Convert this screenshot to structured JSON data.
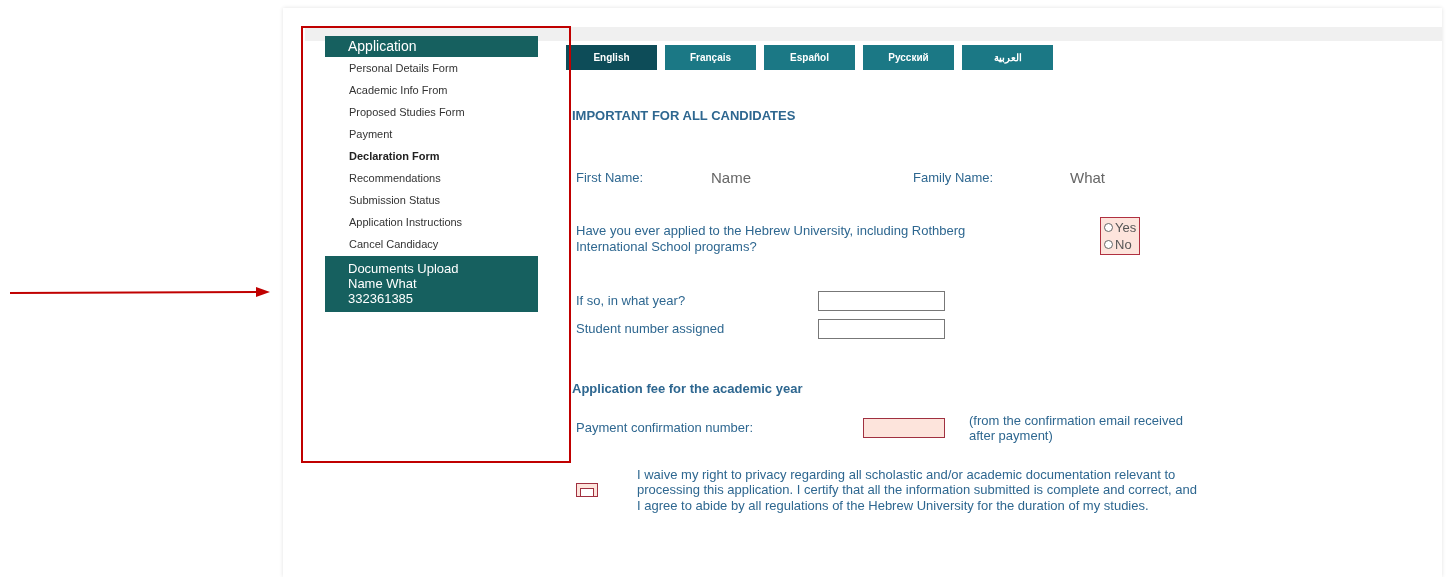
{
  "sidebar": {
    "heading": "Application",
    "items": [
      {
        "label": "Personal Details Form",
        "selected": false
      },
      {
        "label": "Academic Info From",
        "selected": false
      },
      {
        "label": "Proposed Studies Form",
        "selected": false
      },
      {
        "label": "Payment",
        "selected": false
      },
      {
        "label": "Declaration Form",
        "selected": true
      },
      {
        "label": "Recommendations",
        "selected": false
      },
      {
        "label": "Submission Status",
        "selected": false
      },
      {
        "label": "Application Instructions",
        "selected": false
      },
      {
        "label": "Cancel Candidacy",
        "selected": false
      }
    ],
    "documents_box": [
      "Documents Upload",
      "Name What",
      "332361385"
    ]
  },
  "tabs": [
    {
      "label": "English",
      "selected": true
    },
    {
      "label": "Français",
      "selected": false
    },
    {
      "label": "Español",
      "selected": false
    },
    {
      "label": "Русский",
      "selected": false
    },
    {
      "label": "العربية",
      "selected": false
    }
  ],
  "form": {
    "heading": "IMPORTANT FOR ALL CANDIDATES",
    "first_name_label": "First Name:",
    "first_name_value": "Name",
    "family_name_label": "Family Name:",
    "family_name_value": "What",
    "applied_question": "Have you ever applied to the Hebrew University, including Rothberg International School programs?",
    "applied_options": [
      {
        "label": "Yes",
        "selected": false
      },
      {
        "label": "No",
        "selected": false
      }
    ],
    "year_label": "If so, in what year?",
    "student_number_label": "Student number assigned",
    "fee_heading": "Application fee for the academic year",
    "payment_label": "Payment confirmation number:",
    "payment_note": "(from the confirmation email received after payment)",
    "waiver_checked": false,
    "waiver_text": "I waive my right to privacy regarding all scholastic and/or academic documentation relevant to processing this application. I certify that all the information submitted is complete and correct, and I agree to abide by all regulations of the Hebrew University for the duration of my studies."
  }
}
